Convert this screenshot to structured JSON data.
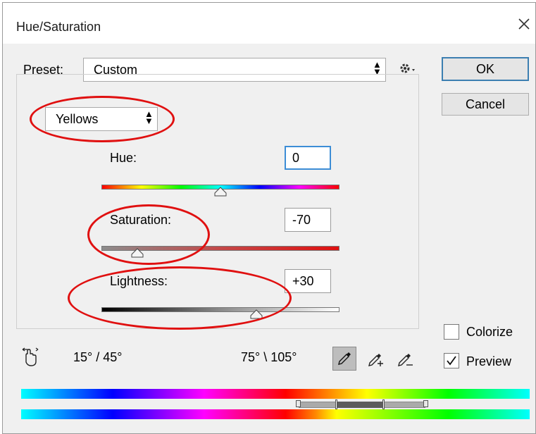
{
  "window": {
    "title": "Hue/Saturation"
  },
  "preset": {
    "label": "Preset:",
    "value": "Custom",
    "arrows": "⬍"
  },
  "buttons": {
    "ok": "OK",
    "cancel": "Cancel"
  },
  "channel": {
    "value": "Yellows",
    "arrows": "⬍"
  },
  "hue": {
    "label": "Hue:",
    "value": "0",
    "position": 0.5
  },
  "saturation": {
    "label": "Saturation:",
    "value": "-70",
    "position": 0.15
  },
  "lightness": {
    "label": "Lightness:",
    "value": "+30",
    "position": 0.65
  },
  "range": {
    "left": "15° / 45°",
    "right": "75° \\ 105°"
  },
  "options": {
    "colorize": "Colorize",
    "preview": "Preview"
  },
  "checks": {
    "colorize": false,
    "preview": true
  },
  "icons": {
    "gear": "gear-icon",
    "hand": "hand-adjust-icon",
    "eyedropper": "eyedropper-icon",
    "eyedropper_plus": "eyedropper-plus-icon",
    "eyedropper_minus": "eyedropper-minus-icon",
    "close": "close-icon"
  },
  "colors": {
    "annotation": "#e01010",
    "focus": "#3c8dd6"
  }
}
